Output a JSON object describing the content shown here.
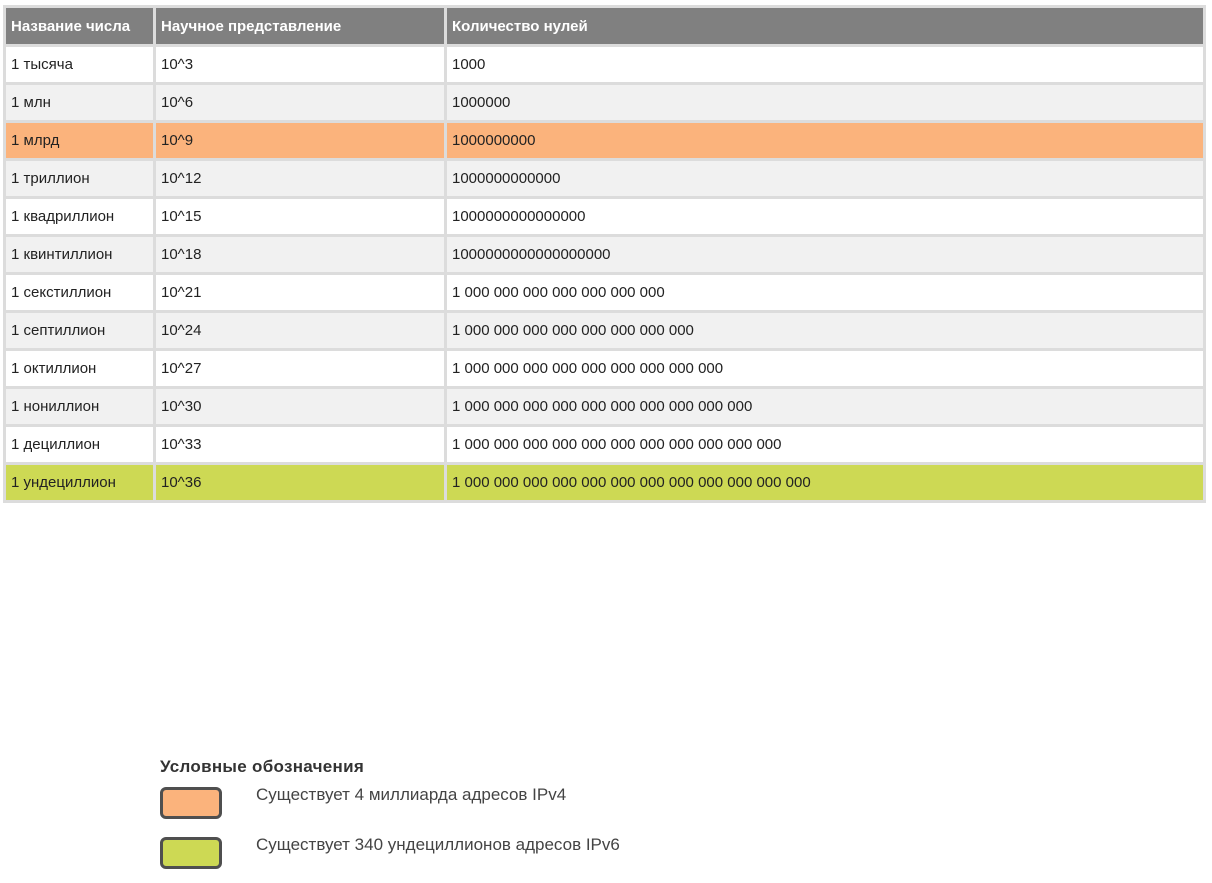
{
  "table": {
    "headers": [
      "Название числа",
      "Научное представление",
      "Количество нулей"
    ],
    "rows": [
      {
        "name": "1 тысяча",
        "scientific": "10^3",
        "zeros": "1000",
        "highlight": ""
      },
      {
        "name": "1 млн",
        "scientific": "10^6",
        "zeros": "1000000",
        "highlight": ""
      },
      {
        "name": "1 млрд",
        "scientific": "10^9",
        "zeros": "1000000000",
        "highlight": "ipv4"
      },
      {
        "name": "1 триллион",
        "scientific": "10^12",
        "zeros": "1000000000000",
        "highlight": ""
      },
      {
        "name": "1 квадриллион",
        "scientific": "10^15",
        "zeros": "1000000000000000",
        "highlight": ""
      },
      {
        "name": "1 квинтиллион",
        "scientific": "10^18",
        "zeros": "1000000000000000000",
        "highlight": ""
      },
      {
        "name": "1 секстиллион",
        "scientific": "10^21",
        "zeros": "1 000 000 000 000 000 000 000",
        "highlight": ""
      },
      {
        "name": "1 септиллион",
        "scientific": "10^24",
        "zeros": "1 000 000 000 000 000 000 000 000",
        "highlight": ""
      },
      {
        "name": "1 октиллион",
        "scientific": "10^27",
        "zeros": "1 000 000 000 000 000 000 000 000 000",
        "highlight": ""
      },
      {
        "name": "1 нониллион",
        "scientific": "10^30",
        "zeros": "1 000 000 000 000 000 000 000 000 000 000",
        "highlight": ""
      },
      {
        "name": "1 дециллион",
        "scientific": "10^33",
        "zeros": "1 000 000 000 000 000 000 000 000 000 000 000",
        "highlight": ""
      },
      {
        "name": "1 ундециллион",
        "scientific": "10^36",
        "zeros": "1 000 000 000 000 000 000 000 000 000 000 000 000",
        "highlight": "ipv6"
      }
    ]
  },
  "legend": {
    "title": "Условные обозначения",
    "items": [
      {
        "key": "ipv4",
        "label": "Существует 4 миллиарда адресов IPv4"
      },
      {
        "key": "ipv6",
        "label": "Существует 340 ундециллионов адресов IPv6"
      }
    ]
  },
  "colors": {
    "header_bg": "#808080",
    "ipv4": "#fbb37c",
    "ipv6": "#cdd954"
  }
}
